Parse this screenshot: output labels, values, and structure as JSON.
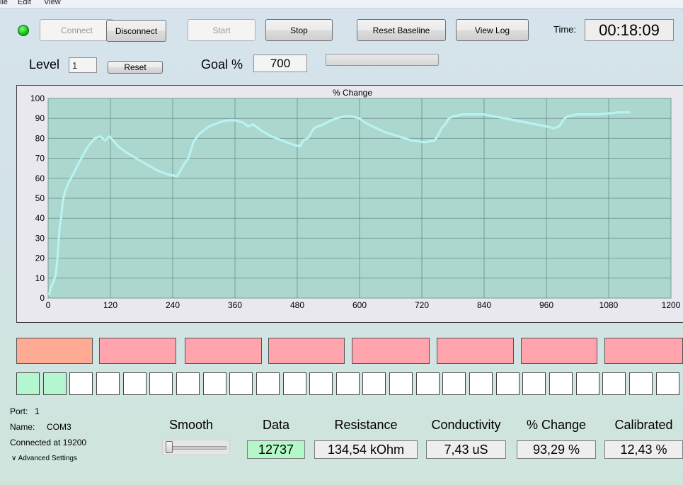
{
  "menu": {
    "items": [
      "ile",
      "Edit",
      "View"
    ]
  },
  "toolbar": {
    "connect_label": "Connect",
    "disconnect_label": "Disconnect",
    "start_label": "Start",
    "stop_label": "Stop",
    "reset_baseline_label": "Reset Baseline",
    "view_log_label": "View Log",
    "time_label": "Time:",
    "time_value": "00:18:09",
    "status_led_color": "#11c611"
  },
  "level_row": {
    "level_label": "Level",
    "level_value": "1",
    "reset_label": "Reset",
    "goal_label": "Goal %",
    "goal_value": "700",
    "progress_fraction": 0
  },
  "chart_data": {
    "type": "line",
    "title": "% Change",
    "xlabel": "",
    "ylabel": "",
    "xlim": [
      0,
      1200
    ],
    "ylim": [
      0,
      100
    ],
    "x_ticks": [
      0,
      120,
      240,
      360,
      480,
      600,
      720,
      840,
      960,
      1080,
      1200
    ],
    "y_ticks": [
      0,
      10,
      20,
      30,
      40,
      50,
      60,
      70,
      80,
      90,
      100
    ],
    "grid": true,
    "background": "#acd7cf",
    "line_color": "#b9f3f1",
    "series": [
      {
        "x": [
          2,
          5,
          10,
          15,
          18,
          20,
          22,
          25,
          28,
          32,
          40,
          50,
          60,
          70,
          80,
          90,
          100,
          110,
          118,
          125,
          135,
          150,
          170,
          190,
          210,
          230,
          248,
          255,
          262,
          270,
          280,
          290,
          300,
          310,
          320,
          330,
          345,
          360,
          375,
          385,
          395,
          410,
          430,
          450,
          470,
          485,
          492,
          500,
          512,
          520,
          530,
          545,
          555,
          570,
          585,
          600,
          610,
          625,
          650,
          675,
          700,
          725,
          745,
          752,
          758,
          765,
          772,
          780,
          800,
          820,
          840,
          860,
          880,
          900,
          920,
          940,
          960,
          975,
          985,
          992,
          1000,
          1020,
          1040,
          1060,
          1080,
          1100,
          1120
        ],
        "y": [
          2,
          5,
          8,
          12,
          20,
          28,
          35,
          40,
          48,
          53,
          58,
          63,
          68,
          73,
          77,
          80,
          81,
          79,
          81,
          79,
          76,
          73,
          70,
          67,
          64,
          62,
          61,
          64,
          67,
          70,
          78,
          82,
          84,
          86,
          87,
          88,
          89,
          89,
          88,
          86,
          87,
          84,
          81,
          79,
          77,
          76,
          79,
          80,
          85,
          86,
          87,
          89,
          90,
          91,
          91,
          90,
          88,
          86,
          83,
          81,
          79,
          78,
          79,
          82,
          85,
          87,
          90,
          91,
          92,
          92,
          92,
          91,
          90,
          89,
          88,
          87,
          86,
          85,
          86,
          89,
          91,
          92,
          92,
          92,
          92.5,
          93,
          93
        ]
      }
    ]
  },
  "indicators": {
    "bars": [
      {
        "color": "#ffaa92"
      },
      {
        "color": "#ffa3ad"
      },
      {
        "color": "#ffa3ad"
      },
      {
        "color": "#ffa3ad"
      },
      {
        "color": "#ffa3ad"
      },
      {
        "color": "#ffa3ad"
      },
      {
        "color": "#ffa3ad"
      },
      {
        "color": "#ffa3ad"
      }
    ],
    "cells_filled": 2,
    "cell_fill_color": "#b4f6cf",
    "cell_count": 25
  },
  "connection": {
    "port_label": "Port:",
    "port_value": "1",
    "name_label": "Name:",
    "name_value": "COM3",
    "status_text": "Connected at 19200",
    "advanced_label": "Advanced Settings"
  },
  "readouts": {
    "smooth_label": "Smooth",
    "smooth_level": 0,
    "data_label": "Data",
    "data_value": "12737",
    "data_color": "#b4f8c8",
    "resistance_label": "Resistance",
    "resistance_value": "134,54 kOhm",
    "conductivity_label": "Conductivity",
    "conductivity_value": "7,43 uS",
    "pct_change_label": "% Change",
    "pct_change_value": "93,29 %",
    "calibrated_label": "Calibrated",
    "calibrated_value": "12,43 %"
  }
}
